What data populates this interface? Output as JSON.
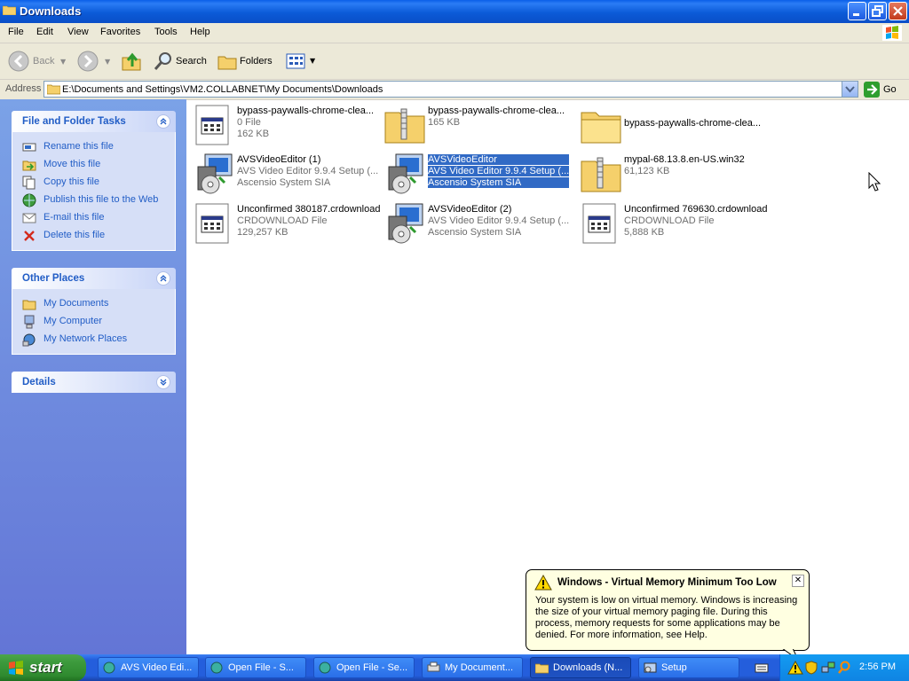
{
  "window": {
    "title": "Downloads"
  },
  "menu": [
    "File",
    "Edit",
    "View",
    "Favorites",
    "Tools",
    "Help"
  ],
  "toolbar": {
    "back": "Back",
    "search": "Search",
    "folders": "Folders"
  },
  "address": {
    "label": "Address",
    "path": "E:\\Documents and Settings\\VM2.COLLABNET\\My Documents\\Downloads",
    "go": "Go"
  },
  "tasks_panel": {
    "title": "File and Folder Tasks",
    "items": [
      "Rename this file",
      "Move this file",
      "Copy this file",
      "Publish this file to the Web",
      "E-mail this file",
      "Delete this file"
    ]
  },
  "places_panel": {
    "title": "Other Places",
    "items": [
      "My Documents",
      "My Computer",
      "My Network Places"
    ]
  },
  "details_panel": {
    "title": "Details"
  },
  "files": [
    {
      "name": "bypass-paywalls-chrome-clea...",
      "line2": "0 File",
      "line3": "162 KB",
      "icon": "generic-file"
    },
    {
      "name": "bypass-paywalls-chrome-clea...",
      "line2": "165 KB",
      "line3": "",
      "icon": "zip-folder"
    },
    {
      "name": "bypass-paywalls-chrome-clea...",
      "line2": "",
      "line3": "",
      "icon": "folder"
    },
    {
      "name": "AVSVideoEditor (1)",
      "line2": "AVS Video Editor 9.9.4 Setup (...",
      "line3": "Ascensio System SIA",
      "icon": "installer"
    },
    {
      "name": "AVSVideoEditor",
      "line2": "AVS Video Editor 9.9.4 Setup (...",
      "line3": "Ascensio System SIA",
      "icon": "installer",
      "selected": true
    },
    {
      "name": "mypal-68.13.8.en-US.win32",
      "line2": "61,123 KB",
      "line3": "",
      "icon": "zip-folder"
    },
    {
      "name": "Unconfirmed 380187.crdownload",
      "line2": "CRDOWNLOAD File",
      "line3": "129,257 KB",
      "icon": "generic-file"
    },
    {
      "name": "AVSVideoEditor (2)",
      "line2": "AVS Video Editor 9.9.4 Setup (...",
      "line3": "Ascensio System SIA",
      "icon": "installer"
    },
    {
      "name": "Unconfirmed 769630.crdownload",
      "line2": "CRDOWNLOAD File",
      "line3": "5,888 KB",
      "icon": "generic-file"
    }
  ],
  "balloon": {
    "title": "Windows - Virtual Memory Minimum Too Low",
    "body": "Your system is low on virtual memory. Windows is increasing the size of your virtual memory paging file. During this process, memory requests for some applications may be denied. For more information, see Help."
  },
  "taskbar": {
    "start": "start",
    "buttons": [
      "AVS Video Edi...",
      "Open File - S...",
      "Open File - Se...",
      "My Document...",
      "Downloads (N...",
      "Setup"
    ],
    "active_index": 4,
    "clock": "2:56 PM"
  },
  "colors": {
    "accent": "#0a5ee8",
    "task_link": "#215dc6",
    "selection": "#316ac5",
    "start_green": "#3c9a3c"
  }
}
